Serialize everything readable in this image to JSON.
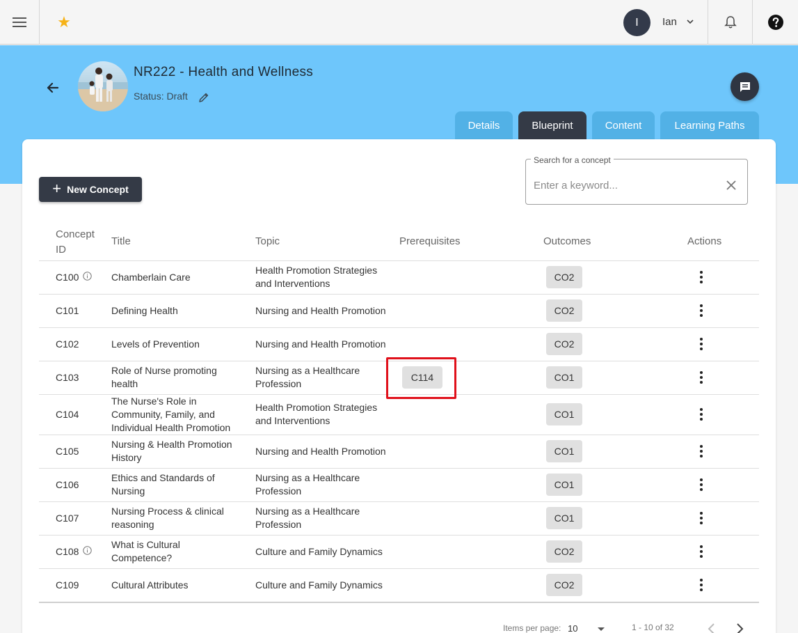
{
  "topbar": {
    "user_initial": "I",
    "user_name": "Ian"
  },
  "course": {
    "title": "NR222 - Health and Wellness",
    "status": "Status: Draft"
  },
  "tabs": [
    {
      "label": "Details",
      "active": false
    },
    {
      "label": "Blueprint",
      "active": true
    },
    {
      "label": "Content",
      "active": false
    },
    {
      "label": "Learning Paths",
      "active": false
    }
  ],
  "toolbar": {
    "new_concept_label": "New Concept"
  },
  "search": {
    "legend": "Search for a concept",
    "placeholder": "Enter a keyword..."
  },
  "table": {
    "headers": {
      "concept_id": "Concept ID",
      "title": "Title",
      "topic": "Topic",
      "prerequisites": "Prerequisites",
      "outcomes": "Outcomes",
      "actions": "Actions"
    },
    "rows": [
      {
        "id": "C100",
        "info": true,
        "title": "Chamberlain Care",
        "topic": "Health Promotion Strategies and Interventions",
        "prereq": "",
        "outcome": "CO2"
      },
      {
        "id": "C101",
        "info": false,
        "title": "Defining Health",
        "topic": "Nursing and Health Promotion",
        "prereq": "",
        "outcome": "CO2"
      },
      {
        "id": "C102",
        "info": false,
        "title": "Levels of Prevention",
        "topic": "Nursing and Health Promotion",
        "prereq": "",
        "outcome": "CO2"
      },
      {
        "id": "C103",
        "info": false,
        "title": "Role of Nurse promoting health",
        "topic": "Nursing as a Healthcare Profession",
        "prereq": "C114",
        "outcome": "CO1"
      },
      {
        "id": "C104",
        "info": false,
        "title": "The Nurse's Role in Community, Family, and Individual Health Promotion",
        "topic": "Health Promotion Strategies and Interventions",
        "prereq": "",
        "outcome": "CO1"
      },
      {
        "id": "C105",
        "info": false,
        "title": "Nursing & Health Promotion History",
        "topic": "Nursing and Health Promotion",
        "prereq": "",
        "outcome": "CO1"
      },
      {
        "id": "C106",
        "info": false,
        "title": "Ethics and Standards of Nursing",
        "topic": "Nursing as a Healthcare Profession",
        "prereq": "",
        "outcome": "CO1"
      },
      {
        "id": "C107",
        "info": false,
        "title": "Nursing Process & clinical reasoning",
        "topic": "Nursing as a Healthcare Profession",
        "prereq": "",
        "outcome": "CO1"
      },
      {
        "id": "C108",
        "info": true,
        "title": "What is Cultural Competence?",
        "topic": "Culture and Family Dynamics",
        "prereq": "",
        "outcome": "CO2"
      },
      {
        "id": "C109",
        "info": false,
        "title": "Cultural Attributes",
        "topic": "Culture and Family Dynamics",
        "prereq": "",
        "outcome": "CO2"
      }
    ]
  },
  "pagination": {
    "items_per_page_label": "Items per page:",
    "items_per_page": "10",
    "range": "1 - 10 of 32"
  },
  "colors": {
    "header_blue": "#6ec6fb",
    "tab_blue": "#52b1e6",
    "dark": "#343a46",
    "star": "#f6b217",
    "highlight": "#e0101a"
  }
}
